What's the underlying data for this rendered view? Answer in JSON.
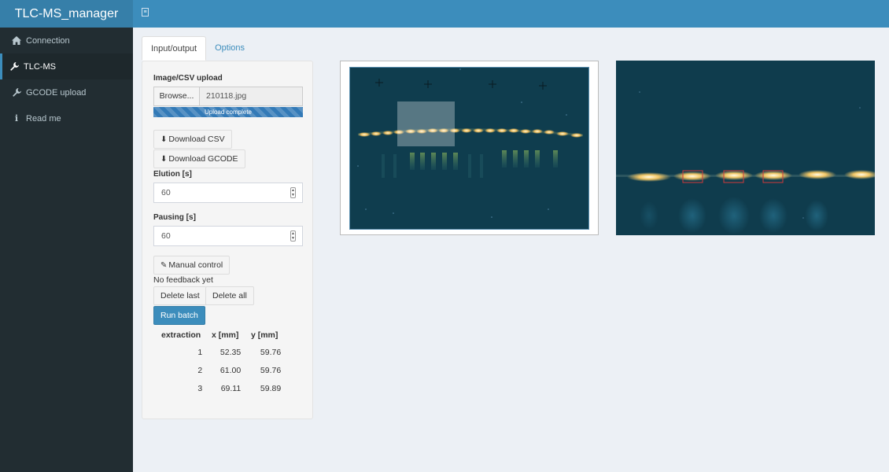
{
  "app": {
    "title": "TLC-MS_manager"
  },
  "sidebar": {
    "items": [
      {
        "label": "Connection",
        "icon": "home-icon"
      },
      {
        "label": "TLC-MS",
        "icon": "wrench-icon",
        "active": true
      },
      {
        "label": "GCODE upload",
        "icon": "wrench-icon"
      },
      {
        "label": "Read me",
        "icon": "info-icon"
      }
    ]
  },
  "tabs": [
    {
      "label": "Input/output",
      "active": true
    },
    {
      "label": "Options"
    }
  ],
  "upload": {
    "label": "Image/CSV upload",
    "browse_label": "Browse...",
    "filename": "210118.jpg",
    "progress_text": "Upload complete",
    "progress": 1.0
  },
  "buttons": {
    "download_csv": "Download CSV",
    "download_gcode": "Download GCODE",
    "manual_control": "Manual control",
    "delete_last": "Delete last",
    "delete_all": "Delete all",
    "run_batch": "Run batch"
  },
  "elution": {
    "label": "Elution [s]",
    "value": "60"
  },
  "pausing": {
    "label": "Pausing [s]",
    "value": "60"
  },
  "feedback": "No feedback yet",
  "table": {
    "headers": [
      "extraction",
      "x [mm]",
      "y [mm]"
    ],
    "rows": [
      [
        "1",
        "52.35",
        "59.76"
      ],
      [
        "2",
        "61.00",
        "59.76"
      ],
      [
        "3",
        "69.11",
        "59.89"
      ]
    ]
  },
  "colors": {
    "header": "#3c8dbc",
    "logo": "#367fa9",
    "sidebar": "#222d32",
    "primary": "#3c8dbc"
  }
}
